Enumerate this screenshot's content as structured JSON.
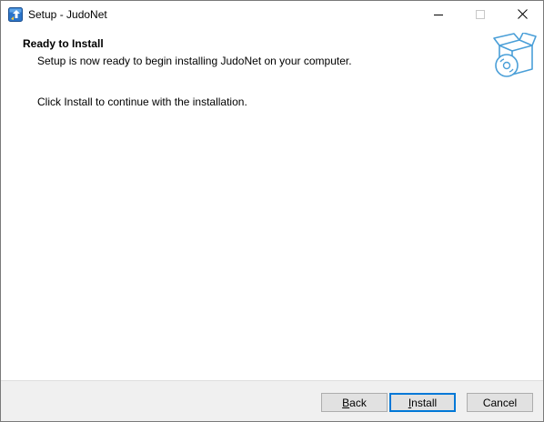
{
  "window": {
    "title": "Setup - JudoNet"
  },
  "titlebar": {
    "minimize_icon": "minimize-icon",
    "maximize_icon": "maximize-icon",
    "close_icon": "close-icon"
  },
  "header": {
    "title": "Ready to Install",
    "subtitle": "Setup is now ready to begin installing JudoNet on your computer.",
    "image_icon": "box-disc-icon"
  },
  "body": {
    "text": "Click Install to continue with the installation."
  },
  "buttons": {
    "back": {
      "accel": "B",
      "rest": "ack"
    },
    "install": {
      "accel": "I",
      "rest": "nstall"
    },
    "cancel": "Cancel"
  },
  "colors": {
    "accent": "#0078d7",
    "footer_bg": "#f0f0f0",
    "icon_blue": "#4a9fd8"
  }
}
